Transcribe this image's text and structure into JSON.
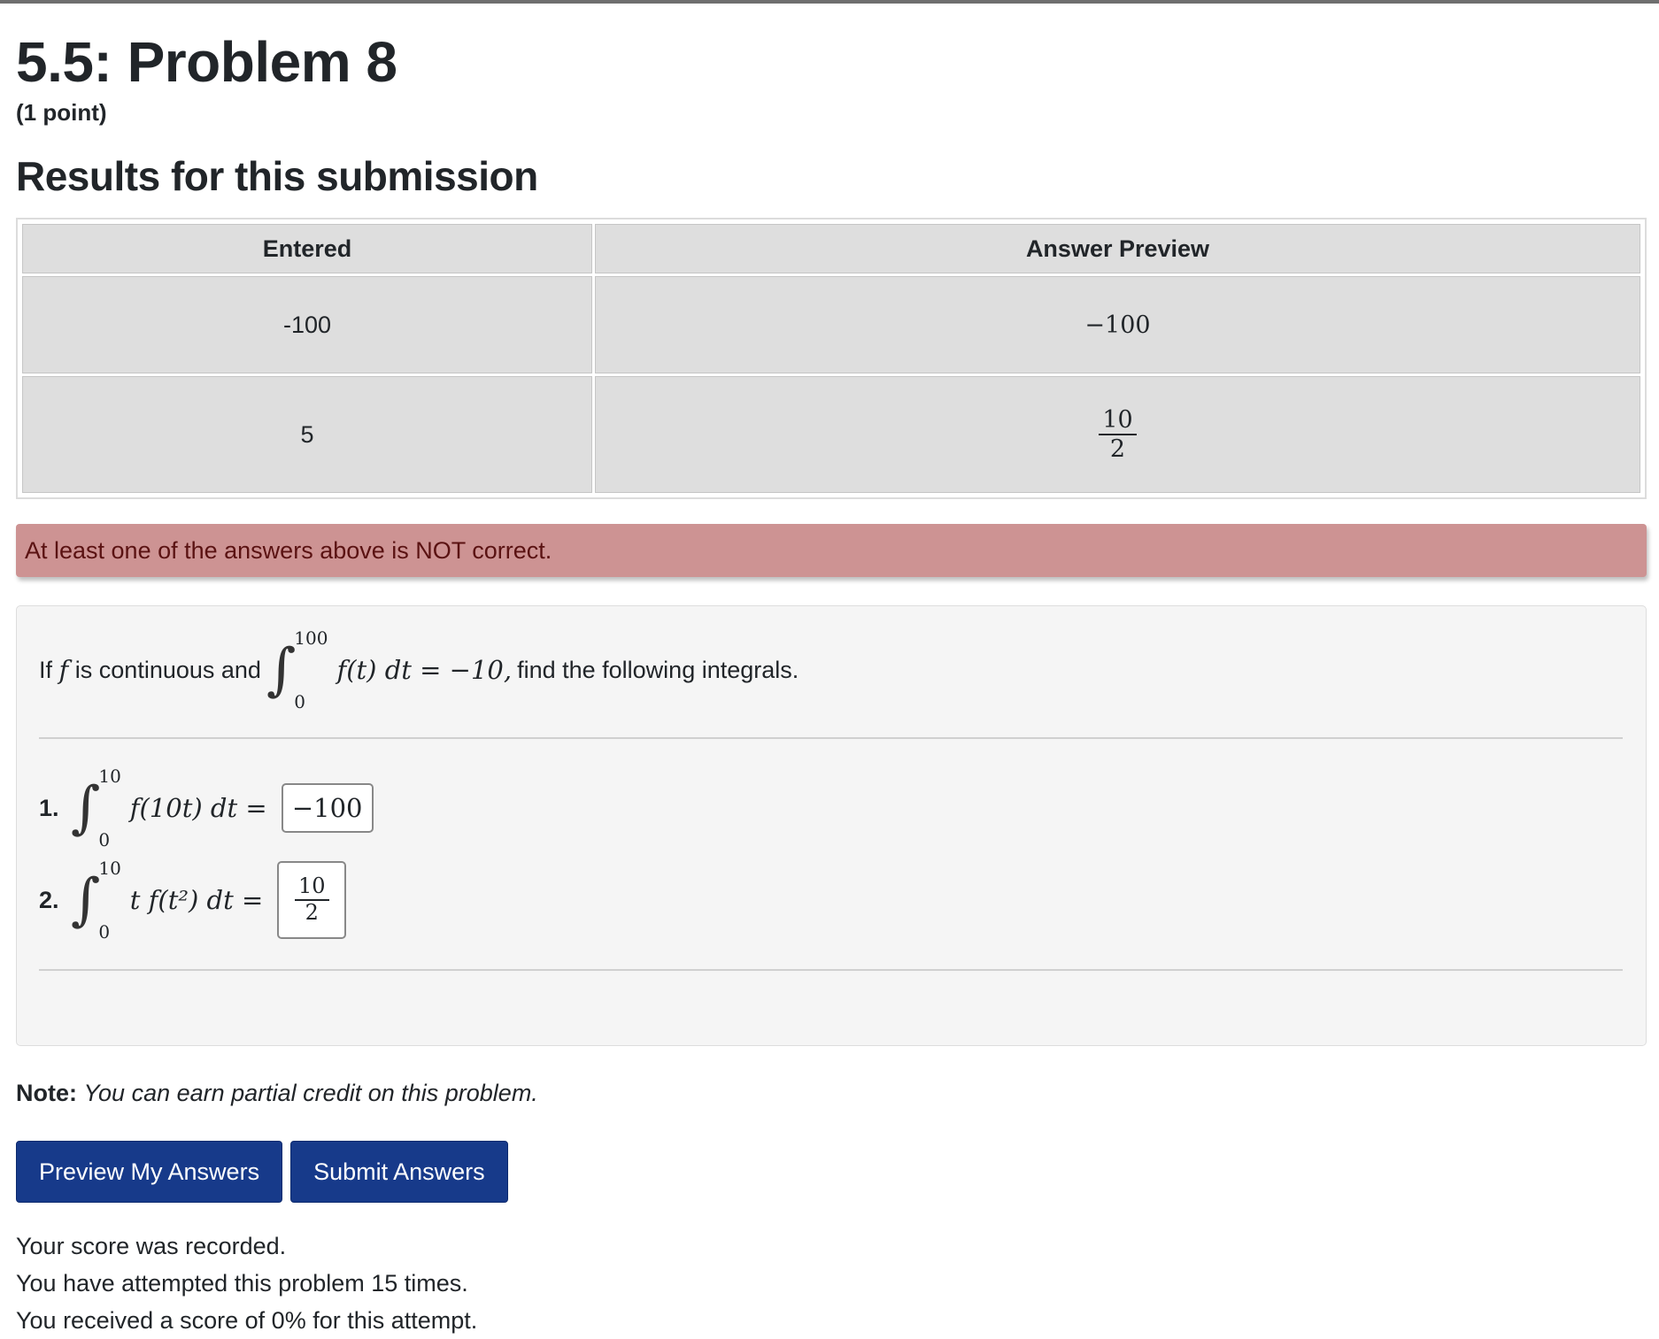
{
  "problem": {
    "title": "5.5: Problem 8",
    "points": "(1 point)"
  },
  "results": {
    "heading": "Results for this submission",
    "columns": [
      "Entered",
      "Answer Preview"
    ],
    "rows": [
      {
        "entered": "-100",
        "preview": "−100"
      },
      {
        "entered": "5",
        "preview_num": "10",
        "preview_den": "2"
      }
    ]
  },
  "alert": {
    "text": "At least one of the answers above is NOT correct.",
    "color": "#cd9393"
  },
  "statement": {
    "prefix": "If",
    "var": "f",
    "mid": "is continuous and",
    "upper": "100",
    "lower": "0",
    "integrand": "f(t) dt = −10,",
    "suffix": "find the following integrals."
  },
  "parts": [
    {
      "num": "1.",
      "upper": "10",
      "lower": "0",
      "integrand": "f(10t) dt =",
      "answer": "−100"
    },
    {
      "num": "2.",
      "upper": "10",
      "lower": "0",
      "integrand": "t f(t²) dt =",
      "answer_num": "10",
      "answer_den": "2"
    }
  ],
  "note": {
    "label": "Note:",
    "text": "You can earn partial credit on this problem."
  },
  "buttons": {
    "preview": "Preview My Answers",
    "submit": "Submit Answers",
    "color": "#173a8a"
  },
  "status": {
    "line1": "Your score was recorded.",
    "line2": "You have attempted this problem 15 times.",
    "line3": "You received a score of 0% for this attempt."
  }
}
